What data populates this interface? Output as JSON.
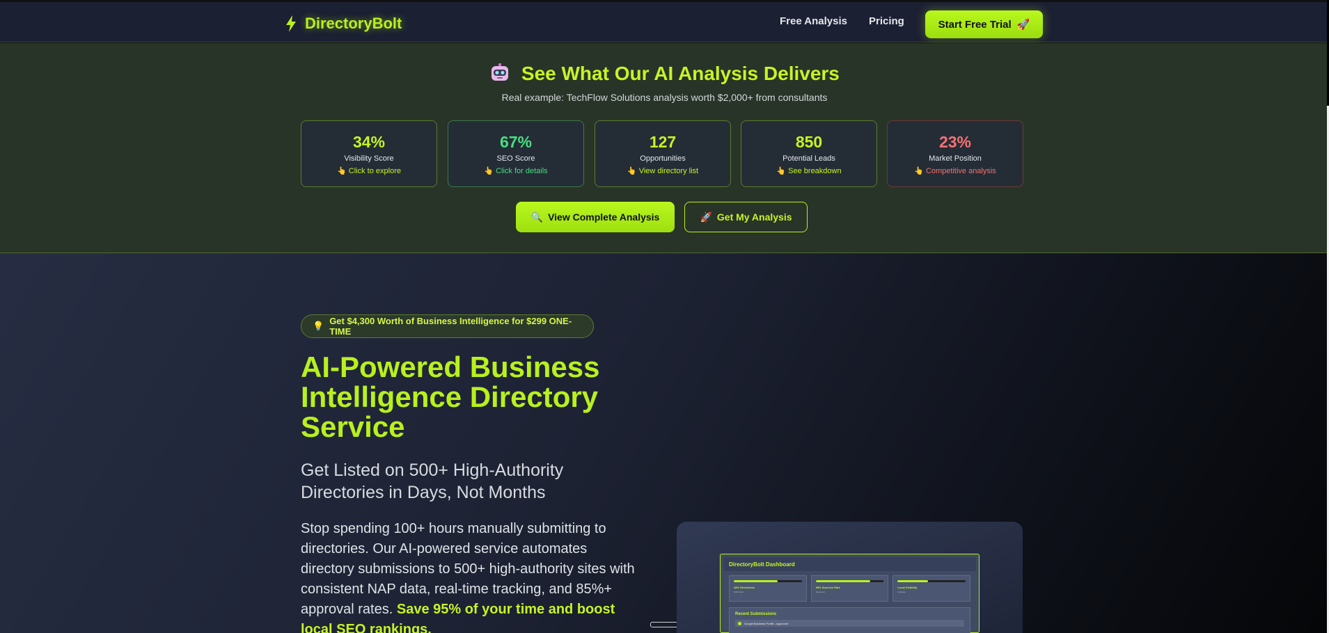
{
  "header": {
    "brand": "DirectoryBolt",
    "nav": [
      "Free Analysis",
      "Pricing"
    ],
    "cta_label": "Start Free Trial",
    "cta_icon": "rocket-icon"
  },
  "analysis": {
    "title": "See What Our AI Analysis Delivers",
    "subtitle": "Real example: TechFlow Solutions analysis worth $2,000+ from consultants",
    "metrics": [
      {
        "value": "34%",
        "label": "Visibility Score",
        "cta": "Click to explore",
        "color": "#c6f425",
        "border": "#5b7c2a"
      },
      {
        "value": "67%",
        "label": "SEO Score",
        "cta": "Click for details",
        "color": "#4ade80",
        "border": "#3e7a4e"
      },
      {
        "value": "127",
        "label": "Opportunities",
        "cta": "View directory list",
        "color": "#c6f425",
        "border": "#5b7c2a"
      },
      {
        "value": "850",
        "label": "Potential Leads",
        "cta": "See breakdown",
        "color": "#c6f425",
        "border": "#5b7c2a"
      },
      {
        "value": "23%",
        "label": "Market Position",
        "cta": "Competitive analysis",
        "color": "#f87171",
        "border": "#6e3a3a"
      }
    ],
    "cta_icon_name": "pointing-hand-icon",
    "view_button": "View Complete Analysis",
    "get_button": "Get My Analysis"
  },
  "hero": {
    "pill": "Get $4,300 Worth of Business Intelligence for $299 ONE-TIME",
    "title": "AI-Powered Business Intelligence Directory Service",
    "subtitle": "Get Listed on 500+ High-Authority Directories in Days, Not Months",
    "paragraph": "Stop spending 100+ hours manually submitting to directories. Our AI-powered service automates directory submissions to 500+ high-authority sites with consistent NAP data, real-time tracking, and 85%+ approval rates.",
    "paragraph_highlight": "Save 95% of your time and boost local SEO rankings."
  },
  "dashboard": {
    "title": "DirectoryBolt Dashboard",
    "tiles": [
      {
        "label": "48% Directories",
        "sub": "Submitted",
        "progress": 0.65
      },
      {
        "label": "98% Success Rate",
        "sub": "Approved",
        "progress": 0.8
      },
      {
        "label": "Local Visibility",
        "sub": "Increase",
        "progress": 0.45
      }
    ],
    "recent_title": "Recent Submissions",
    "recent_item": "Google Business Profile - Approved"
  },
  "colors": {
    "accent": "#b8f11c",
    "bg": "#1b2033",
    "band": "#283428"
  }
}
